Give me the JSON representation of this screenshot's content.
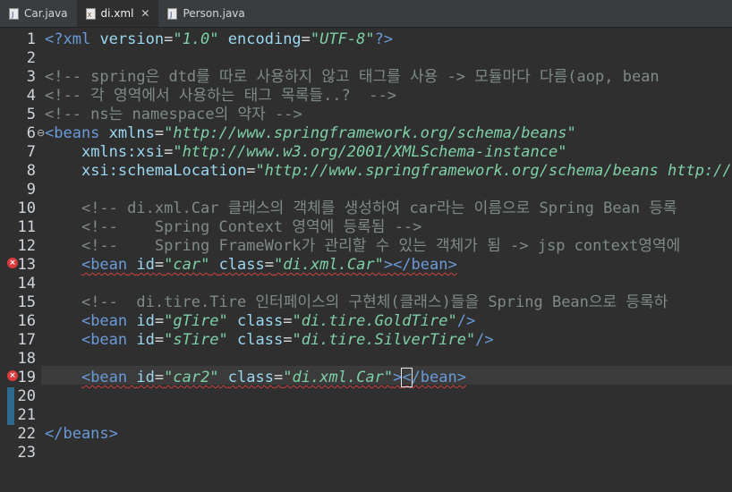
{
  "tabs": [
    {
      "label": "Car.java",
      "icon": "java-file-icon",
      "active": false
    },
    {
      "label": "di.xml",
      "icon": "xml-file-icon",
      "active": true,
      "close": "✕"
    },
    {
      "label": "Person.java",
      "icon": "java-file-icon",
      "active": false
    }
  ],
  "line_numbers": [
    "1",
    "2",
    "3",
    "4",
    "5",
    "6",
    "7",
    "8",
    "9",
    "10",
    "11",
    "12",
    "13",
    "14",
    "15",
    "16",
    "17",
    "18",
    "19",
    "20",
    "21",
    "22",
    "23"
  ],
  "code": {
    "l1": {
      "open": "<?xml",
      "a1": "version",
      "v1": "\"1.0\"",
      "a2": "encoding",
      "v2": "\"UTF-8\"",
      "close": "?>"
    },
    "l3": "<!-- spring은 dtd를 따로 사용하지 않고 태그를 사용 -> 모듈마다 다름(aop, bean",
    "l4": "<!-- 각 영역에서 사용하는 태그 목록들..?  -->",
    "l5": "<!-- ns는 namespace의 약자 -->",
    "l6": {
      "tag": "<beans",
      "attr": "xmlns",
      "val": "\"http://www.springframework.org/schema/beans\""
    },
    "l7": {
      "attr": "xmlns:xsi",
      "val": "\"http://www.w3.org/2001/XMLSchema-instance\""
    },
    "l8": {
      "attr": "xsi:schemaLocation",
      "val": "\"http://www.springframework.org/schema/beans http://ww"
    },
    "l10": "<!-- di.xml.Car 클래스의 객체를 생성하여 car라는 이름으로 Spring Bean 등록",
    "l11": "<!--    Spring Context 영역에 등록됨 -->",
    "l12": "<!--    Spring FrameWork가 관리할 수 있는 객체가 됨 -> jsp context영역에",
    "l13": {
      "tag": "<bean",
      "a1": "id",
      "v1": "\"car\"",
      "a2": "class",
      "v2": "\"di.xml.Car\"",
      "end": "></bean>"
    },
    "l15": "<!--  di.tire.Tire 인터페이스의 구현체(클래스)들을 Spring Bean으로 등록하",
    "l16": {
      "tag": "<bean",
      "a1": "id",
      "v1": "\"gTire\"",
      "a2": "class",
      "v2": "\"di.tire.GoldTire\"",
      "end": "/>"
    },
    "l17": {
      "tag": "<bean",
      "a1": "id",
      "v1": "\"sTire\"",
      "a2": "class",
      "v2": "\"di.tire.SilverTire\"",
      "end": "/>"
    },
    "l19": {
      "tag": "<bean",
      "a1": "id",
      "v1": "\"car2\"",
      "a2": "class",
      "v2": "\"di.xml.Car\"",
      "gt": ">",
      "cursor": "<",
      "end": "/bean>"
    },
    "l22": "</beans>"
  },
  "colors": {
    "background": "#2f2f2f",
    "tag": "#6b9ad8",
    "attr": "#9bd7f0",
    "value": "#7fd0a6",
    "comment": "#7f8b86",
    "error": "#d83b3b"
  }
}
